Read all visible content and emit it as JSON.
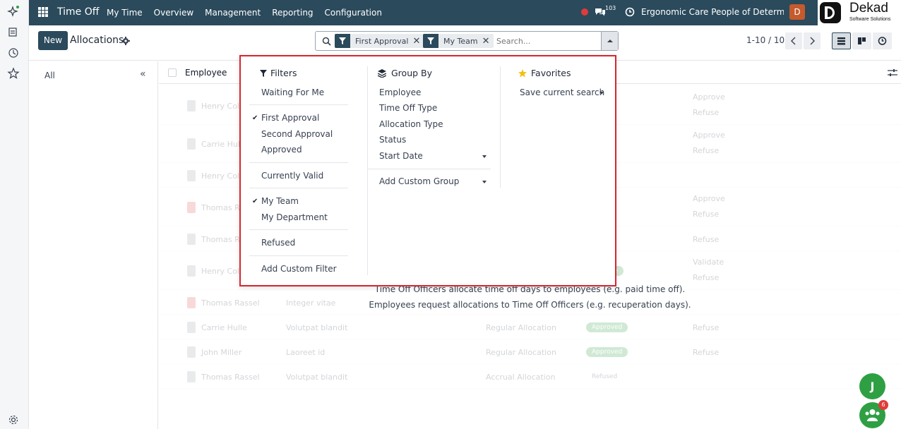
{
  "topbar": {
    "app_title": "Time Off",
    "menu": [
      "My Time",
      "Overview",
      "Management",
      "Reporting",
      "Configuration"
    ],
    "chat_count": "103",
    "company": "Ergonomic Care People of Determina...",
    "user_initial": "D",
    "logo_name": "Dekad",
    "logo_sub": "Software Solutions"
  },
  "control_panel": {
    "new_label": "New",
    "title": "Allocations",
    "facets": [
      "First Approval",
      "My Team"
    ],
    "search_placeholder": "Search...",
    "pager": "1-10 / 10"
  },
  "sidepanel": {
    "all_label": "All",
    "collapse_glyph": "«"
  },
  "list": {
    "employee_header": "Employee",
    "rows": [
      {
        "employee": "Henry Cole",
        "description": "",
        "type": "",
        "status": "",
        "actions": [
          "Approve",
          "Refuse"
        ]
      },
      {
        "employee": "Carrie Hulle",
        "description": "",
        "type": "",
        "status": "",
        "actions": [
          "Approve",
          "Refuse"
        ]
      },
      {
        "employee": "Henry Cole",
        "description": "",
        "type": "",
        "status": "",
        "actions": []
      },
      {
        "employee": "Thomas Rassel",
        "description": "",
        "type": "",
        "status": "",
        "actions": [
          "Approve",
          "Refuse"
        ]
      },
      {
        "employee": "Thomas Rassel",
        "description": "",
        "type": "",
        "status": "",
        "actions": [
          "Refuse"
        ]
      },
      {
        "employee": "Henry Cole",
        "description": "",
        "type": "",
        "status": "Approve",
        "actions": [
          "Validate",
          "Refuse"
        ]
      },
      {
        "employee": "Thomas Rassel",
        "description": "Integer vitae",
        "type": "",
        "status": "",
        "actions": []
      },
      {
        "employee": "Carrie Hulle",
        "description": "Volutpat blandit",
        "type": "Regular Allocation",
        "status": "Approved",
        "actions": [
          "Refuse"
        ]
      },
      {
        "employee": "John Miller",
        "description": "Laoreet id",
        "type": "Regular Allocation",
        "status": "Approved",
        "actions": [
          "Refuse"
        ]
      },
      {
        "employee": "Thomas Rassel",
        "description": "Volutpat blandit",
        "type": "Accrual Allocation",
        "status": "Refused",
        "actions": []
      }
    ],
    "help_line1": "Time Off Officers allocate time off days to employees (e.g. paid time off).",
    "help_line2": "Employees request allocations to Time Off Officers (e.g. recuperation days)."
  },
  "dropdown": {
    "filters": {
      "heading": "Filters",
      "items": [
        "Waiting For Me",
        "First Approval",
        "Second Approval",
        "Approved",
        "Currently Valid",
        "My Team",
        "My Department",
        "Refused",
        "Add Custom Filter"
      ],
      "checked": [
        "First Approval",
        "My Team"
      ],
      "check_glyph": "✔"
    },
    "group_by": {
      "heading": "Group By",
      "items": [
        "Employee",
        "Time Off Type",
        "Allocation Type",
        "Status",
        "Start Date",
        "Add Custom Group"
      ]
    },
    "favorites": {
      "heading": "Favorites",
      "items": [
        "Save current search"
      ]
    }
  },
  "floating": {
    "chat_initial": "J",
    "team_badge": "6"
  },
  "colors": {
    "brand": "#2b4a5c",
    "highlight_border": "#d7262e",
    "green": "#2ea043",
    "status_red": "#e03b3b"
  }
}
